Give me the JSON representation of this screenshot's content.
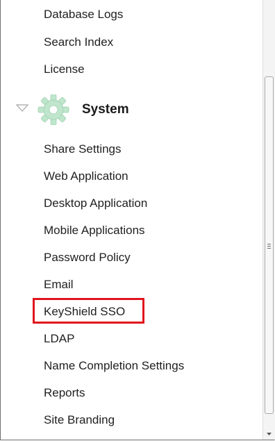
{
  "nav": {
    "top_items": [
      "Database Logs",
      "Search Index",
      "License"
    ],
    "section": {
      "title": "System",
      "items": [
        "Share Settings",
        "Web Application",
        "Desktop Application",
        "Mobile Applications",
        "Password Policy",
        "Email",
        "KeyShield SSO",
        "LDAP",
        "Name Completion Settings",
        "Reports",
        "Site Branding"
      ]
    },
    "highlighted_item": "KeyShield SSO"
  },
  "icons": {
    "expand": "chevron-down-icon",
    "section": "gear-icon",
    "scroll_down": "arrow-down-icon"
  },
  "colors": {
    "highlight_border": "#e0141e",
    "gear_fill": "#b9e3c7"
  }
}
